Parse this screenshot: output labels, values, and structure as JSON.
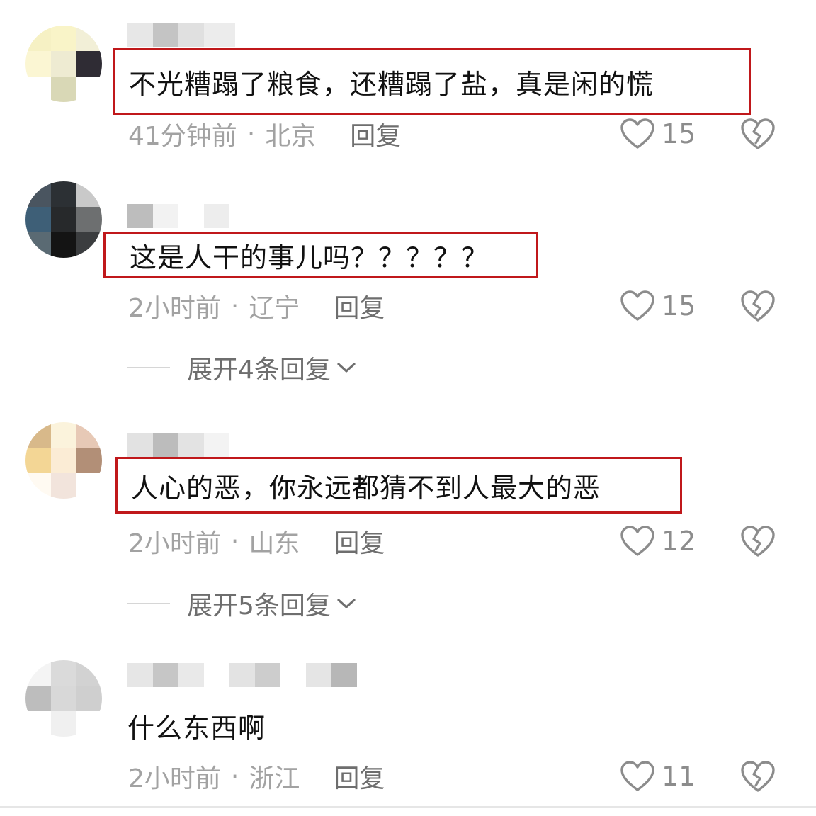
{
  "comments": [
    {
      "text": "不光糟蹋了粮食，还糟蹋了盐，真是闲的慌",
      "time": "41分钟前",
      "separator": "·",
      "location": "北京",
      "reply_label": "回复",
      "likes": "15"
    },
    {
      "text": "这是人干的事儿吗？？？？？",
      "time": "2小时前",
      "separator": "·",
      "location": "辽宁",
      "reply_label": "回复",
      "likes": "15",
      "expand_label": "展开4条回复"
    },
    {
      "text": "人心的恶，你永远都猜不到人最大的恶",
      "time": "2小时前",
      "separator": "·",
      "location": "山东",
      "reply_label": "回复",
      "likes": "12",
      "expand_label": "展开5条回复"
    },
    {
      "text": "什么东西啊",
      "time": "2小时前",
      "separator": "·",
      "location": "浙江",
      "reply_label": "回复",
      "likes": "11"
    }
  ],
  "colors": {
    "highlight_border": "#c0181b",
    "comment_text": "#111111",
    "meta_text": "#a2a2a2",
    "reply_text": "#6e6e6e",
    "icon_stroke": "#8c8c8c"
  },
  "icons": {
    "like": "heart-outline-icon",
    "dislike": "broken-heart-icon",
    "expand": "chevron-down-icon"
  }
}
